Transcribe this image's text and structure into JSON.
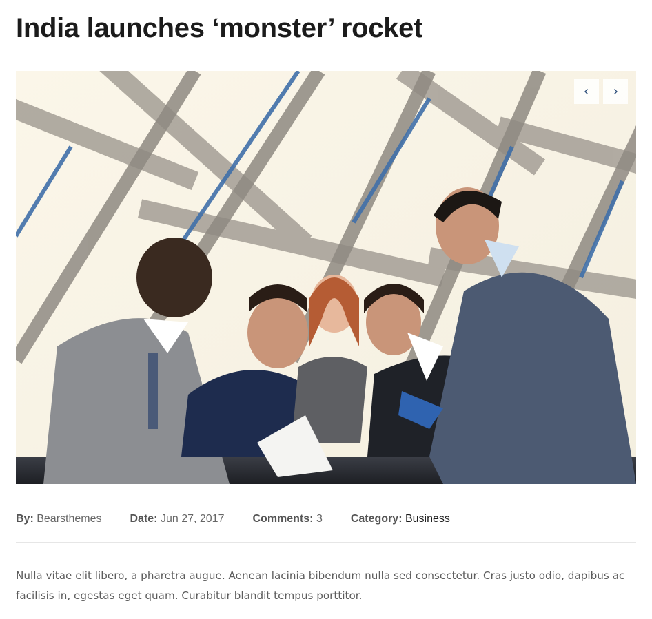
{
  "post": {
    "title": "India launches ‘monster’ rocket",
    "image": {
      "alt": "business team meeting around a table under a glass roof"
    },
    "slider": {
      "prev_icon": "chevron-left-icon",
      "next_icon": "chevron-right-icon"
    },
    "meta": {
      "author_label": "By:",
      "author": "Bearsthemes",
      "date_label": "Date:",
      "date": "Jun 27, 2017",
      "comments_label": "Comments:",
      "comments": "3",
      "category_label": "Category:",
      "category": "Business"
    },
    "excerpt": "Nulla vitae elit libero, a pharetra augue. Aenean lacinia bibendum nulla sed consectetur. Cras justo odio, dapibus ac facilisis in, egestas eget quam. Curabitur blandit tempus porttitor."
  },
  "colors": {
    "accent": "#1b1b1b",
    "meta_text": "#666666",
    "excerpt_text": "#5c5c5c",
    "nav_chevron": "#2c4e7a"
  }
}
